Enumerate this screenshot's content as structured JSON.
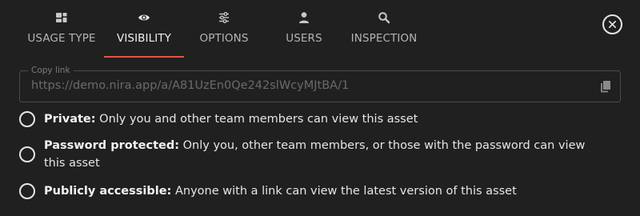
{
  "tabs": [
    {
      "label": "USAGE TYPE",
      "icon": "grid-blocks-icon",
      "active": false
    },
    {
      "label": "VISIBILITY",
      "icon": "eye-icon",
      "active": true
    },
    {
      "label": "OPTIONS",
      "icon": "sliders-icon",
      "active": false
    },
    {
      "label": "USERS",
      "icon": "user-icon",
      "active": false
    },
    {
      "label": "INSPECTION",
      "icon": "search-icon",
      "active": false
    }
  ],
  "close": {
    "icon": "close-icon"
  },
  "copy_link": {
    "legend": "Copy link",
    "value": "https://demo.nira.app/a/A81UzEn0Qe242slWcyMJtBA/1",
    "icon": "copy-icon"
  },
  "visibility_options": [
    {
      "title": "Private:",
      "description": " Only you and other team members can view this asset",
      "selected": false
    },
    {
      "title": "Password protected:",
      "description": " Only you, other team members, or those with the password can view this asset",
      "selected": false
    },
    {
      "title": "Publicly accessible:",
      "description": " Anyone with a link can view the latest version of this asset",
      "selected": false
    }
  ],
  "colors": {
    "background": "#202021",
    "accent_underline": "#e2563f",
    "text": "#e6e6e6",
    "muted_text": "#b4b4b4",
    "field_border": "#4a4a4c"
  }
}
